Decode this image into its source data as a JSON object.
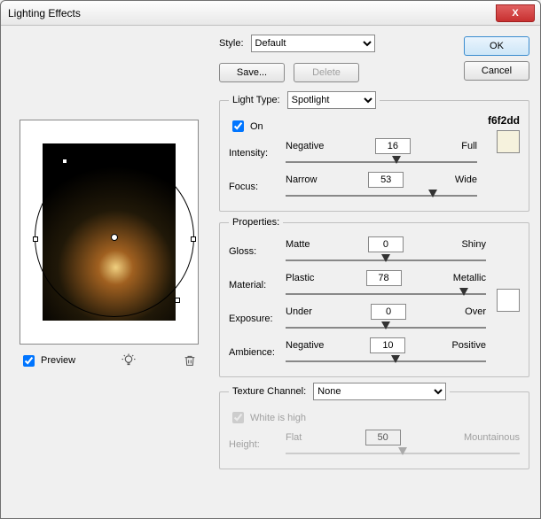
{
  "window": {
    "title": "Lighting Effects"
  },
  "buttons": {
    "ok": "OK",
    "cancel": "Cancel",
    "save": "Save...",
    "delete": "Delete",
    "close": "X"
  },
  "style": {
    "label": "Style:",
    "value": "Default"
  },
  "preview": {
    "label": "Preview",
    "checked": true
  },
  "lightType": {
    "legend": "Light Type:",
    "value": "Spotlight",
    "onLabel": "On",
    "onChecked": true,
    "hex": "f6f2dd",
    "swatchColor": "#f6f2dd",
    "intensity": {
      "label": "Intensity:",
      "left": "Negative",
      "right": "Full",
      "value": "16",
      "pct": 58
    },
    "focus": {
      "label": "Focus:",
      "left": "Narrow",
      "right": "Wide",
      "value": "53",
      "pct": 77
    }
  },
  "properties": {
    "legend": "Properties:",
    "swatchColor": "#ffffff",
    "gloss": {
      "label": "Gloss:",
      "left": "Matte",
      "right": "Shiny",
      "value": "0",
      "pct": 50
    },
    "material": {
      "label": "Material:",
      "left": "Plastic",
      "right": "Metallic",
      "value": "78",
      "pct": 89
    },
    "exposure": {
      "label": "Exposure:",
      "left": "Under",
      "right": "Over",
      "value": "0",
      "pct": 50
    },
    "ambience": {
      "label": "Ambience:",
      "left": "Negative",
      "right": "Positive",
      "value": "10",
      "pct": 55
    }
  },
  "texture": {
    "legend": "Texture Channel:",
    "value": "None",
    "whiteHigh": {
      "label": "White is high",
      "checked": true
    },
    "height": {
      "label": "Height:",
      "left": "Flat",
      "right": "Mountainous",
      "value": "50",
      "pct": 50
    }
  }
}
